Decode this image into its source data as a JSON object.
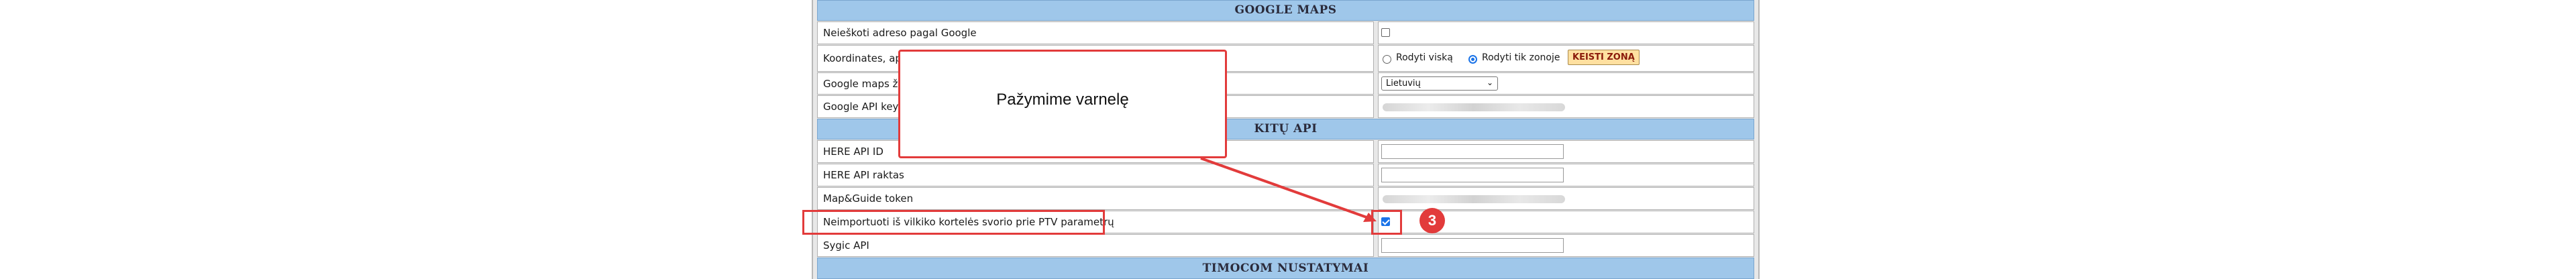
{
  "sections": {
    "google_maps": "GOOGLE MAPS",
    "kitu_api": "KITŲ API",
    "timocom": "TIMOCOM NUSTATYMAI"
  },
  "rows": {
    "r1": {
      "label": "Neieškoti adreso pagal Google",
      "checked": false
    },
    "r2": {
      "label": "Koordinates, apri",
      "radio1": "Rodyti viską",
      "radio2": "Rodyti tik zonoje",
      "radio_selected": "radio2",
      "button": "KEISTI ZONĄ"
    },
    "r3": {
      "label": "Google maps žem",
      "select_value": "Lietuvių"
    },
    "r4": {
      "label": "Google API key"
    },
    "r5": {
      "label": "HERE API ID",
      "value": ""
    },
    "r6": {
      "label": "HERE API raktas",
      "value": ""
    },
    "r7": {
      "label": "Map&Guide token"
    },
    "r8": {
      "label": "Neimportuoti iš vilkiko kortelės svorio prie PTV parametrų",
      "checked": true
    },
    "r9": {
      "label": "Sygic API",
      "value": ""
    }
  },
  "annotation": {
    "callout_text": "Pažymime varnelę",
    "step": "3"
  },
  "colors": {
    "section_header": "#9fc7ea",
    "annotation": "#e23b3b",
    "checkbox_checked": "#1a73e8"
  }
}
